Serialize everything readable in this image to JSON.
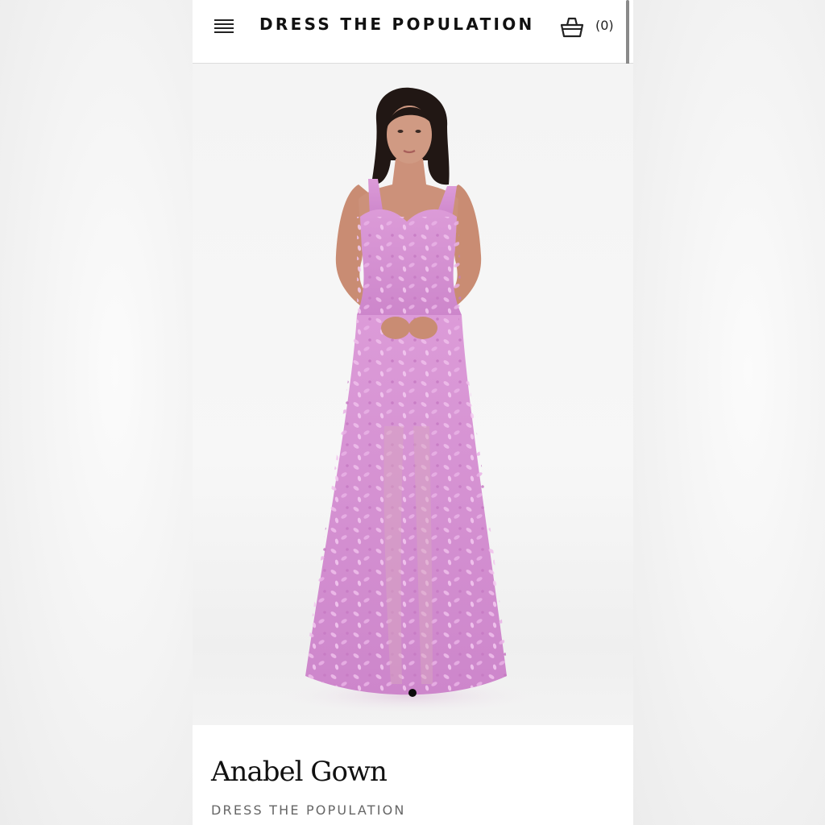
{
  "header": {
    "menu_icon": "hamburger-menu-icon",
    "brand": "DRESS THE POPULATION",
    "cart_icon": "shopping-basket-icon",
    "cart_count": "(0)"
  },
  "gallery": {
    "current_slide": 1,
    "total_slides": 1
  },
  "product": {
    "name": "Anabel Gown",
    "brand": "DRESS THE POPULATION"
  },
  "colors": {
    "gown": "#d78fd4",
    "petal": "#e7b1e3",
    "hair": "#201714",
    "skin": "#c98f76"
  }
}
